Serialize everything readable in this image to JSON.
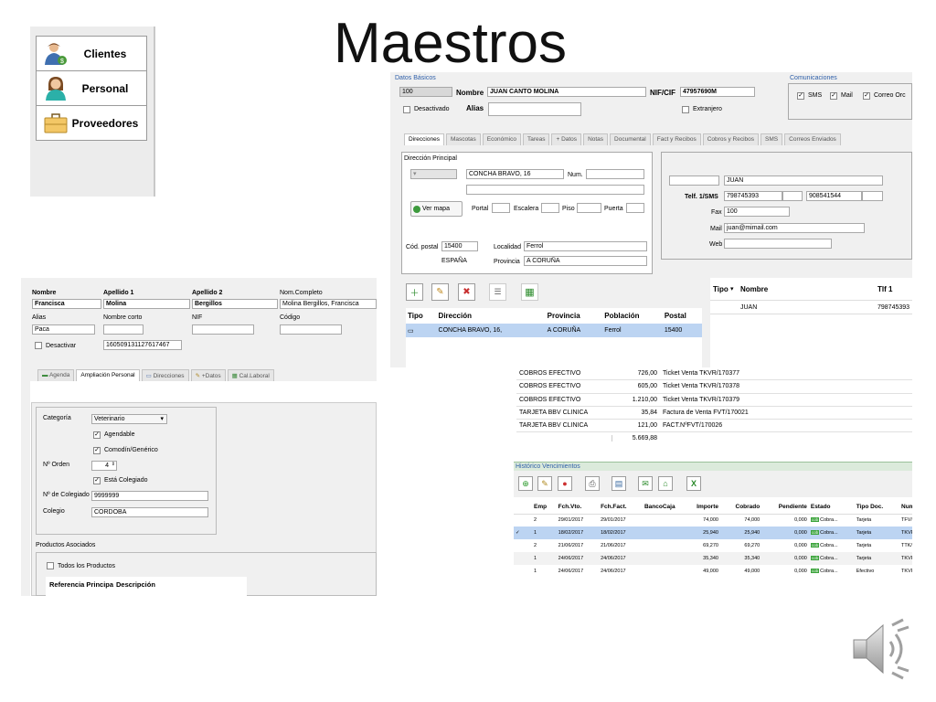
{
  "slide": {
    "title": "Maestros"
  },
  "menu": {
    "items": [
      {
        "label": "Clientes",
        "icon": "client-icon"
      },
      {
        "label": "Personal",
        "icon": "staff-icon"
      },
      {
        "label": "Proveedores",
        "icon": "briefcase-icon"
      }
    ]
  },
  "cliente": {
    "datos_basicos_title": "Datos Básicos",
    "codigo": "100",
    "nombre_label": "Nombre",
    "nombre": "JUAN CANTO MOLINA",
    "nif_label": "NIF/CIF",
    "nif": "47957690M",
    "desactivado_label": "Desactivado",
    "alias_label": "Alias",
    "extranjero_label": "Extranjero",
    "comunicaciones_title": "Comunicaciones",
    "sms_label": "SMS",
    "mail_label": "Mail",
    "correo_label": "Correo Orc",
    "tabs": [
      "Direcciones",
      "Mascotas",
      "Económico",
      "Tareas",
      "+ Datos",
      "Notas",
      "Documental",
      "Fact y Recibos",
      "Cobros y Recibos",
      "SMS",
      "Correos Enviados"
    ],
    "direccion": {
      "title": "Dirección Principal",
      "calle": "CONCHA BRAVO, 16",
      "num_label": "Num.",
      "ver_mapa": "Ver mapa",
      "portal_label": "Portal",
      "escalera_label": "Escalera",
      "piso_label": "Piso",
      "puerta_label": "Puerta",
      "cp_label": "Cód. postal",
      "cp": "15400",
      "localidad_label": "Localidad",
      "localidad": "Ferrol",
      "pais": "ESPAÑA",
      "provincia_label": "Provincia",
      "provincia": "A CORUÑA"
    },
    "contacto": {
      "nombre": "JUAN",
      "tlf_label": "Telf. 1/SMS",
      "tlf1": "798745393",
      "tlf2": "908541544",
      "fax_label": "Fax",
      "fax": "100",
      "mail_label": "Mail",
      "mail": "juan@mimail.com",
      "web_label": "Web"
    },
    "dir_table": {
      "headers": [
        "Tipo",
        "Dirección",
        "Provincia",
        "Población",
        "Postal"
      ],
      "row": [
        "",
        "CONCHA BRAVO, 16,",
        "A CORUÑA",
        "Ferrol",
        "15400"
      ]
    },
    "contact_table": {
      "headers": [
        "Tipo",
        "Nombre",
        "Tlf 1"
      ],
      "row": [
        "",
        "JUAN",
        "798745393"
      ]
    }
  },
  "personal": {
    "labels": {
      "nombre": "Nombre",
      "apellido1": "Apellido 1",
      "apellido2": "Apellido 2",
      "nom_completo": "Nom.Completo",
      "alias": "Alias",
      "nombre_corto": "Nombre corto",
      "nif": "NIF",
      "codigo": "Código",
      "desactivar": "Desactivar"
    },
    "values": {
      "nombre": "Francisca",
      "apellido1": "Molina",
      "apellido2": "Bergillos",
      "nom_completo": "Molina Bergillos, Francisca",
      "alias": "Paca",
      "codigo_barras": "160509131127617467"
    },
    "tabs": [
      "Agenda",
      "Ampliación Personal",
      "Direcciones",
      "+Datos",
      "Cal.Laboral"
    ],
    "categoria_label": "Categoría",
    "categoria": "Veterinario",
    "agendable": "Agendable",
    "comodin": "Comodín/Genérico",
    "orden_label": "Nº Orden",
    "orden": "4",
    "colegiado_chk": "Está Colegiado",
    "num_colegiado_label": "Nº de Colegiado",
    "num_colegiado": "9999999",
    "colegio_label": "Colegio",
    "colegio": "CORDOBA",
    "productos_title": "Productos Asociados",
    "todos_productos": "Todos los Productos",
    "prod_headers": [
      "Referencia Principa",
      "Descripción"
    ]
  },
  "cobros": {
    "rows": [
      {
        "tipo": "COBROS EFECTIVO",
        "importe": "726,00",
        "desc": "Ticket Venta TKVR/170377"
      },
      {
        "tipo": "COBROS EFECTIVO",
        "importe": "605,00",
        "desc": "Ticket Venta TKVR/170378"
      },
      {
        "tipo": "COBROS EFECTIVO",
        "importe": "1.210,00",
        "desc": "Ticket Venta TKVR/170379"
      },
      {
        "tipo": "TARJETA BBV CLINICA",
        "importe": "35,84",
        "desc": "Factura de Venta FVT/170021"
      },
      {
        "tipo": "TARJETA BBV CLINICA",
        "importe": "121,00",
        "desc": "FACT.NºFVT/170026"
      }
    ],
    "total": "5.669,88",
    "historico_title": "Histórico Vencimientos",
    "headers": [
      "Emp",
      "Fch.Vto.",
      "Fch.Fact.",
      "BancoCaja",
      "Importe",
      "Cobrado",
      "Pendiente",
      "Estado",
      "Tipo Doc.",
      "Num Doc"
    ],
    "estado_tag": "cob",
    "rows2": [
      [
        "2",
        "29/01/2017",
        "29/01/2017",
        "",
        "74,000",
        "74,000",
        "0,000",
        "Cobra...",
        "Tarjeta",
        "TFV/2"
      ],
      [
        "1",
        "18/02/2017",
        "18/02/2017",
        "",
        "25,940",
        "25,940",
        "0,000",
        "Cobra...",
        "Tarjeta",
        "TKVR/1701"
      ],
      [
        "2",
        "21/06/2017",
        "21/06/2017",
        "",
        "69,270",
        "69,270",
        "0,000",
        "Cobra...",
        "Tarjeta",
        "TTK/278"
      ],
      [
        "1",
        "24/06/2017",
        "24/06/2017",
        "",
        "35,340",
        "35,340",
        "0,000",
        "Cobra...",
        "Tarjeta",
        "TKVR/1701"
      ],
      [
        "1",
        "24/06/2017",
        "24/06/2017",
        "",
        "49,000",
        "49,000",
        "0,000",
        "Cobra...",
        "Efectivo",
        "TKVR/1701"
      ]
    ]
  }
}
